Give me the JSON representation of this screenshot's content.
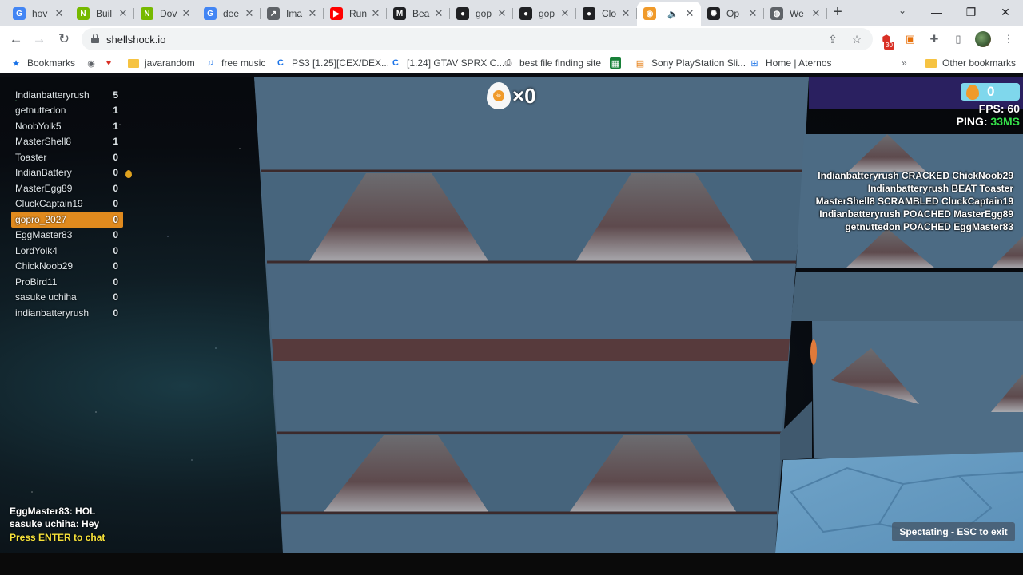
{
  "browser": {
    "tabs": [
      {
        "title": "hov",
        "favicon": "google-multicolor-icon",
        "color": "#4285f4"
      },
      {
        "title": "Buil",
        "favicon": "nvidia-icon",
        "color": "#76b900"
      },
      {
        "title": "Dov",
        "favicon": "nvidia-icon",
        "color": "#76b900"
      },
      {
        "title": "dee",
        "favicon": "google-icon",
        "color": "#4285f4"
      },
      {
        "title": "Ima",
        "favicon": "chart-icon",
        "color": "#5f6368"
      },
      {
        "title": "Run",
        "favicon": "youtube-icon",
        "color": "#ff0000"
      },
      {
        "title": "Bea",
        "favicon": "medium-icon",
        "color": "#202124"
      },
      {
        "title": "gop",
        "favicon": "github-icon",
        "color": "#202124"
      },
      {
        "title": "gop",
        "favicon": "github-icon",
        "color": "#202124"
      },
      {
        "title": "Clo",
        "favicon": "github-icon",
        "color": "#202124"
      },
      {
        "title": "",
        "favicon": "shellshock-icon",
        "color": "#f09a2a",
        "active": true,
        "audio": true
      },
      {
        "title": "Op",
        "favicon": "openai-icon",
        "color": "#202124"
      },
      {
        "title": "We",
        "favicon": "globe-icon",
        "color": "#5f6368"
      }
    ],
    "url": "shellshock.io",
    "extension_badge": "30",
    "bookmarks": [
      {
        "label": "Bookmarks",
        "icon": "star-icon"
      },
      {
        "label": "",
        "icon": "chrome-icon"
      },
      {
        "label": "",
        "icon": "heart-icon"
      },
      {
        "label": "javarandom",
        "icon": "folder-icon"
      },
      {
        "label": "free music",
        "icon": "headset-icon"
      },
      {
        "label": "PS3 [1.25][CEX/DEX...",
        "icon": "site-c-icon"
      },
      {
        "label": "[1.24] GTAV SPRX C...",
        "icon": "site-c-icon"
      },
      {
        "label": "best file finding site",
        "icon": "printer-icon"
      },
      {
        "label": "",
        "icon": "green-site-icon"
      },
      {
        "label": "Sony PlayStation Sli...",
        "icon": "shopping-icon"
      },
      {
        "label": "Home | Aternos",
        "icon": "aternos-icon"
      }
    ],
    "other_bookmarks": "Other bookmarks"
  },
  "game": {
    "scoreboard": [
      {
        "name": "Indianbatteryrush",
        "score": "5"
      },
      {
        "name": "getnuttedon",
        "score": "1"
      },
      {
        "name": "NoobYolk5",
        "score": "1"
      },
      {
        "name": "MasterShell8",
        "score": "1"
      },
      {
        "name": "Toaster",
        "score": "0"
      },
      {
        "name": "IndianBattery",
        "score": "0",
        "egg": true
      },
      {
        "name": "MasterEgg89",
        "score": "0"
      },
      {
        "name": "CluckCaptain19",
        "score": "0"
      },
      {
        "name": "gopro_2027",
        "score": "0",
        "me": true
      },
      {
        "name": "EggMaster83",
        "score": "0"
      },
      {
        "name": "LordYolk4",
        "score": "0"
      },
      {
        "name": "ChickNoob29",
        "score": "0"
      },
      {
        "name": "ProBird11",
        "score": "0"
      },
      {
        "name": "sasuke uchiha",
        "score": "0"
      },
      {
        "name": "indianbatteryrush",
        "score": "0"
      }
    ],
    "kill_streak": "×0",
    "eggs": "0",
    "fps_label": "FPS: 60",
    "ping_label": "PING: ",
    "ping_value": "33MS",
    "killfeed": [
      "Indianbatteryrush CRACKED ChickNoob29",
      "Indianbatteryrush BEAT Toaster",
      "MasterShell8 SCRAMBLED CluckCaptain19",
      "Indianbatteryrush POACHED MasterEgg89",
      "getnuttedon POACHED EggMaster83"
    ],
    "chat": [
      "EggMaster83: HOL",
      "sasuke uchiha: Hey"
    ],
    "chat_prompt": "Press ENTER to chat",
    "spectate": "Spectating - ESC to exit"
  }
}
